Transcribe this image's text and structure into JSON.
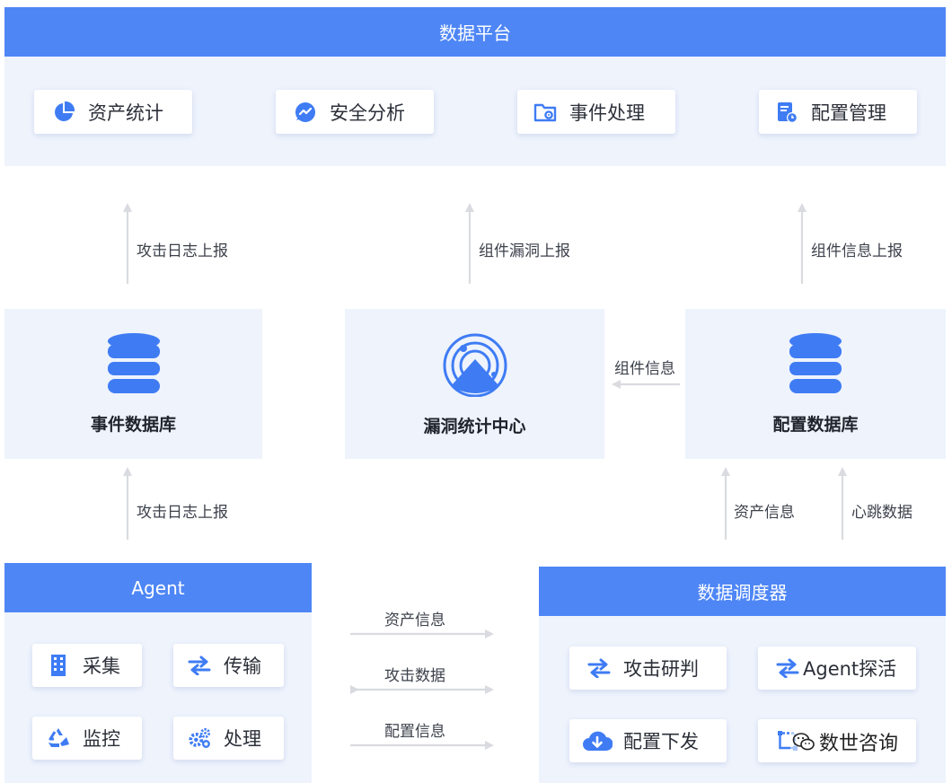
{
  "platform": {
    "title": "数据平台",
    "modules": [
      {
        "label": "资产统计",
        "icon": "pie-chart-icon"
      },
      {
        "label": "安全分析",
        "icon": "analysis-chat-icon"
      },
      {
        "label": "事件处理",
        "icon": "folder-gear-icon"
      },
      {
        "label": "配置管理",
        "icon": "document-clock-icon"
      }
    ]
  },
  "flows": {
    "left_up": "攻击日志上报",
    "mid_up": "组件漏洞上报",
    "right_up": "组件信息上报",
    "component_info": "组件信息",
    "agent_to_eventdb": "攻击日志上报",
    "asset_info_up": "资产信息",
    "heartbeat_up": "心跳数据",
    "mid_asset": "资产信息",
    "mid_attack": "攻击数据",
    "mid_config": "配置信息"
  },
  "nodes": {
    "event_db": "事件数据库",
    "vuln_center": "漏洞统计中心",
    "config_db": "配置数据库"
  },
  "agent": {
    "title": "Agent",
    "functions": [
      {
        "label": "采集",
        "icon": "building-icon"
      },
      {
        "label": "传输",
        "icon": "swap-arrows-icon"
      },
      {
        "label": "监控",
        "icon": "recycle-icon"
      },
      {
        "label": "处理",
        "icon": "gears-icon"
      }
    ]
  },
  "scheduler": {
    "title": "数据调度器",
    "functions": [
      {
        "label": "攻击研判",
        "icon": "swap-arrows-icon"
      },
      {
        "label": "Agent探活",
        "icon": "swap-arrows-icon"
      },
      {
        "label": "配置下发",
        "icon": "cloud-download-icon"
      },
      {
        "label": "",
        "icon": "flow-icon"
      }
    ]
  },
  "watermark": {
    "text": "数世咨询",
    "icon": "wechat-icon"
  },
  "colors": {
    "primary": "#4e86f6",
    "panel": "#eef3fc",
    "arrow": "#d9dbe0"
  }
}
